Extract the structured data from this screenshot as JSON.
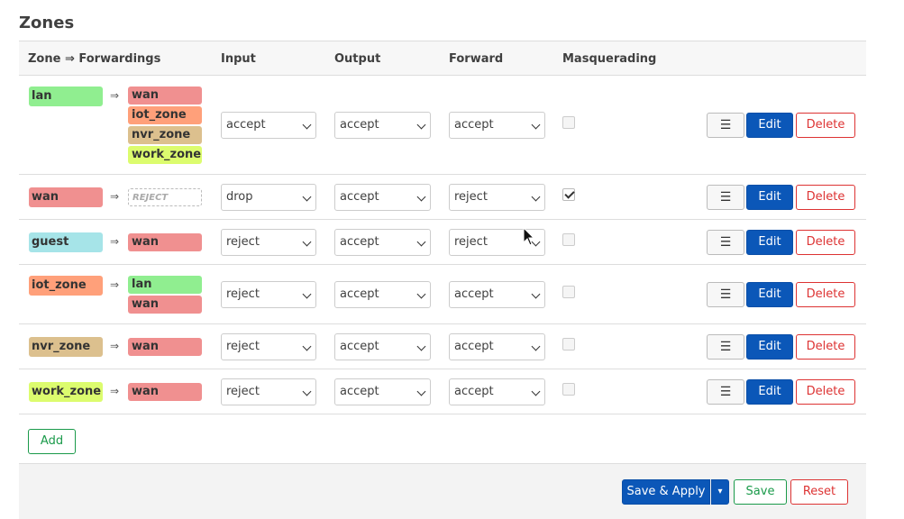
{
  "page": {
    "title": "Zones"
  },
  "table": {
    "headers": {
      "zone": "Zone ⇒ Forwardings",
      "input": "Input",
      "output": "Output",
      "forward": "Forward",
      "masq": "Masquerading"
    },
    "arrow": "⇒",
    "rows": [
      {
        "zone": "lan",
        "forwards": [
          "wan",
          "iot_zone",
          "nvr_zone",
          "work_zone"
        ],
        "input": "accept",
        "output": "accept",
        "forward": "accept",
        "masq": false
      },
      {
        "zone": "wan",
        "forwards": [
          "REJECT"
        ],
        "input": "drop",
        "output": "accept",
        "forward": "reject",
        "masq": true
      },
      {
        "zone": "guest",
        "forwards": [
          "wan"
        ],
        "input": "reject",
        "output": "accept",
        "forward": "reject",
        "masq": false
      },
      {
        "zone": "iot_zone",
        "forwards": [
          "lan",
          "wan"
        ],
        "input": "reject",
        "output": "accept",
        "forward": "accept",
        "masq": false
      },
      {
        "zone": "nvr_zone",
        "forwards": [
          "wan"
        ],
        "input": "reject",
        "output": "accept",
        "forward": "accept",
        "masq": false
      },
      {
        "zone": "work_zone",
        "forwards": [
          "wan"
        ],
        "input": "reject",
        "output": "accept",
        "forward": "accept",
        "masq": false
      }
    ],
    "row_buttons": {
      "menu": "☰",
      "edit": "Edit",
      "delete": "Delete"
    }
  },
  "zone_colors": {
    "lan": "#90ee90",
    "wan": "#f09090",
    "guest": "#a6e4e8",
    "iot_zone": "#ffa07a",
    "nvr_zone": "#dcc08e",
    "work_zone": "#dcfc6e"
  },
  "actions": {
    "add": "Add",
    "save_apply": "Save & Apply",
    "save_apply_dropdown": "▾",
    "save": "Save",
    "reset": "Reset"
  }
}
